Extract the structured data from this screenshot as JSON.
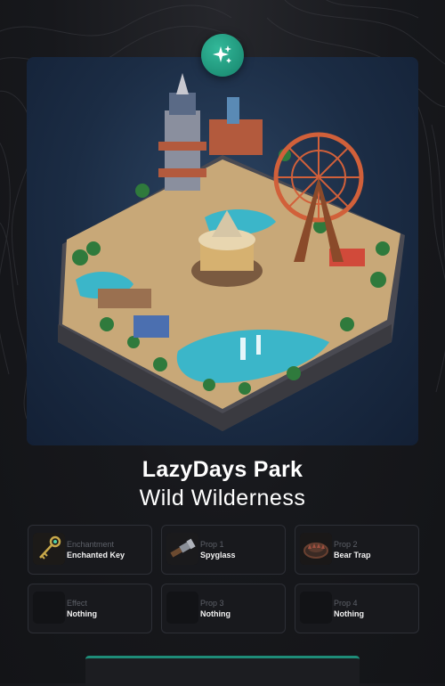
{
  "card": {
    "title": "LazyDays Park",
    "subtitle": "Wild Wilderness",
    "badge_icon": "sparkles-icon",
    "accent_color": "#1f9c82"
  },
  "slots": [
    {
      "label": "Enchantment",
      "value": "Enchanted Key",
      "icon": "key-icon"
    },
    {
      "label": "Prop 1",
      "value": "Spyglass",
      "icon": "spyglass-icon"
    },
    {
      "label": "Prop 2",
      "value": "Bear Trap",
      "icon": "bear-trap-icon"
    },
    {
      "label": "Effect",
      "value": "Nothing",
      "icon": "empty-slot-icon"
    },
    {
      "label": "Prop 3",
      "value": "Nothing",
      "icon": "empty-slot-icon"
    },
    {
      "label": "Prop 4",
      "value": "Nothing",
      "icon": "empty-slot-icon"
    }
  ]
}
